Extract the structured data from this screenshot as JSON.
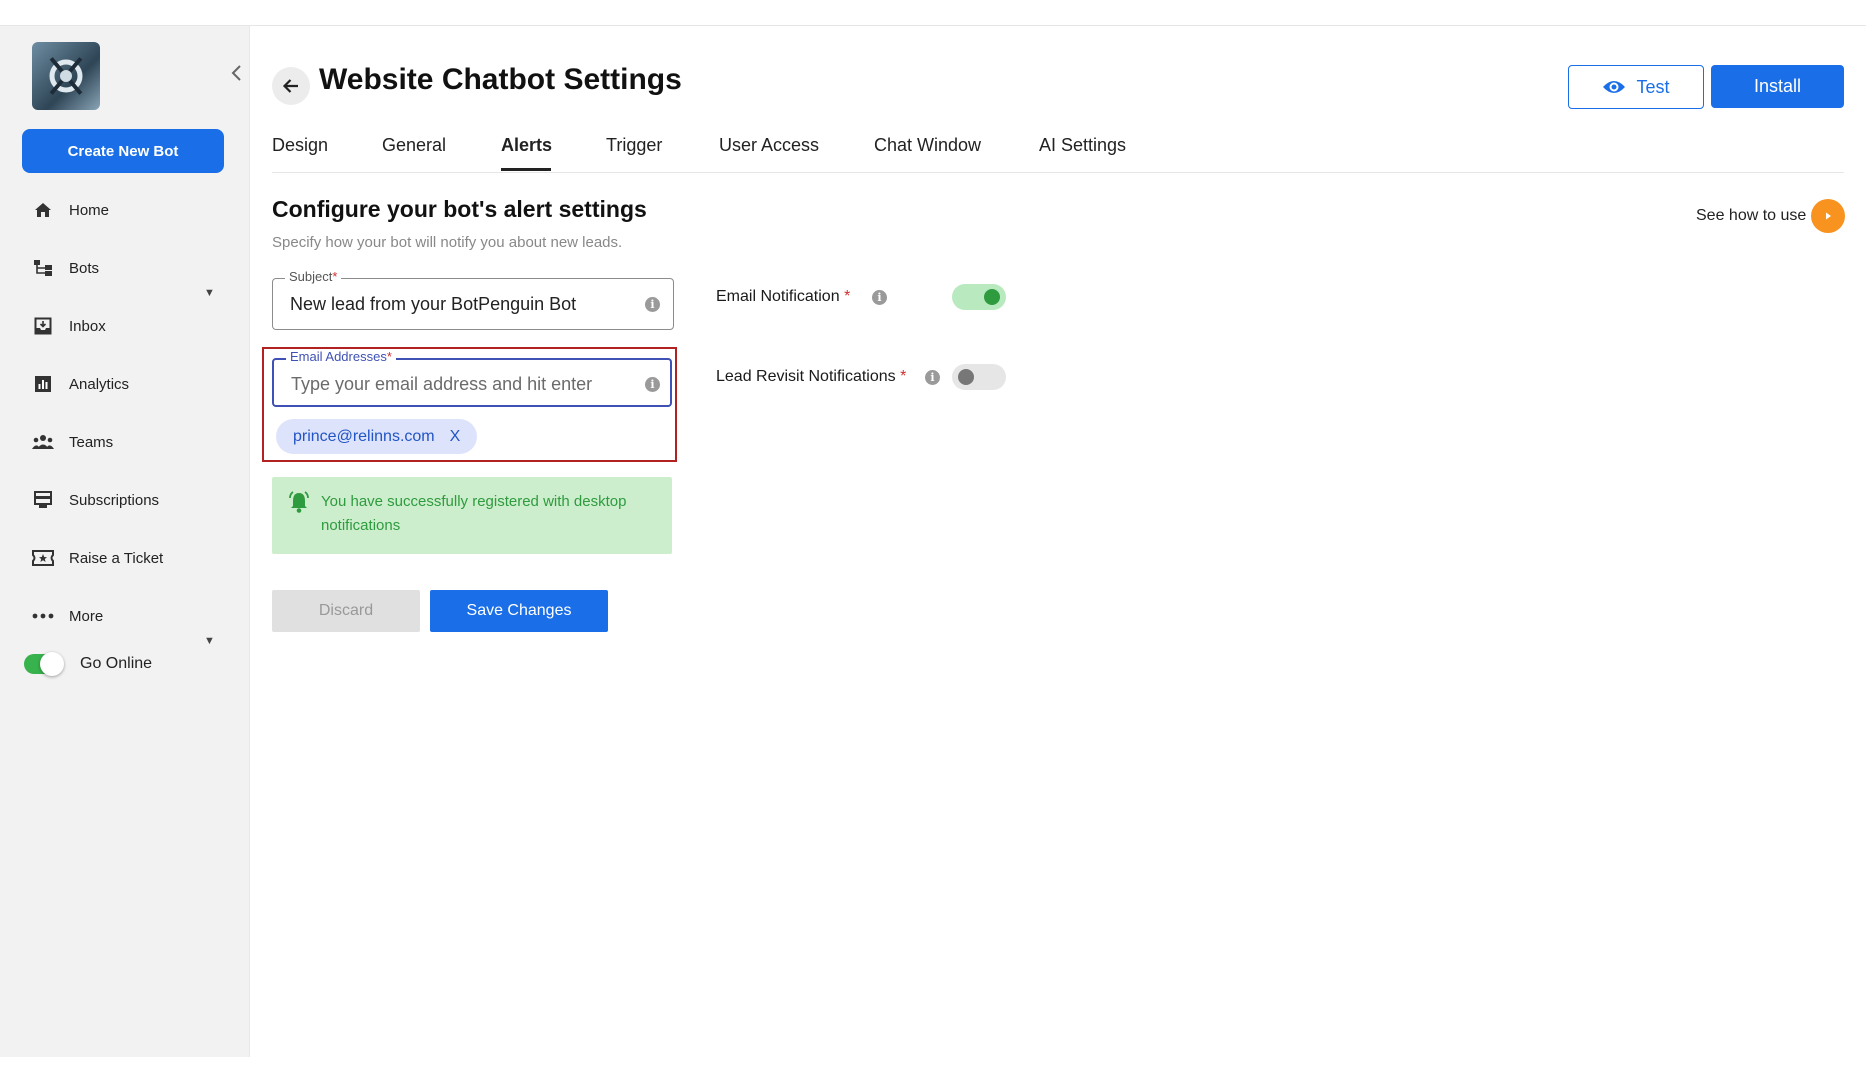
{
  "sidebar": {
    "create_label": "Create New Bot",
    "items": [
      {
        "label": "Home",
        "icon": "home-icon"
      },
      {
        "label": "Bots",
        "icon": "bots-icon"
      },
      {
        "label": "Inbox",
        "icon": "inbox-icon"
      },
      {
        "label": "Analytics",
        "icon": "analytics-icon"
      },
      {
        "label": "Teams",
        "icon": "teams-icon"
      },
      {
        "label": "Subscriptions",
        "icon": "subscriptions-icon"
      },
      {
        "label": "Raise a Ticket",
        "icon": "ticket-icon"
      },
      {
        "label": "More",
        "icon": "more-icon"
      }
    ],
    "go_online_label": "Go Online",
    "go_online_state": true
  },
  "header": {
    "title": "Website Chatbot Settings",
    "test_label": "Test",
    "install_label": "Install"
  },
  "tabs": [
    {
      "label": "Design"
    },
    {
      "label": "General"
    },
    {
      "label": "Alerts"
    },
    {
      "label": "Trigger"
    },
    {
      "label": "User Access"
    },
    {
      "label": "Chat Window"
    },
    {
      "label": "AI Settings"
    }
  ],
  "active_tab": "Alerts",
  "main": {
    "section_title": "Configure your bot's alert settings",
    "section_subtitle": "Specify how your bot will notify you about new leads.",
    "see_how_label": "See how to use",
    "subject": {
      "label": "Subject",
      "value": "New lead from your BotPenguin Bot"
    },
    "email": {
      "label": "Email Addresses",
      "placeholder": "Type your email address and hit enter",
      "value": ""
    },
    "emails": [
      "prince@relinns.com"
    ],
    "chip_remove": "X",
    "notice": "You have successfully registered with desktop notifications",
    "discard_label": "Discard",
    "save_label": "Save Changes",
    "email_notification": {
      "label": "Email Notification",
      "state": true
    },
    "lead_revisit": {
      "label": "Lead Revisit Notifications",
      "state": false
    },
    "required_mark": "*",
    "info_glyph": "i"
  },
  "colors": {
    "accent": "#1a6ee8",
    "success": "#2e9b3e",
    "highlight_border": "#b22222",
    "play": "#f7931e"
  }
}
